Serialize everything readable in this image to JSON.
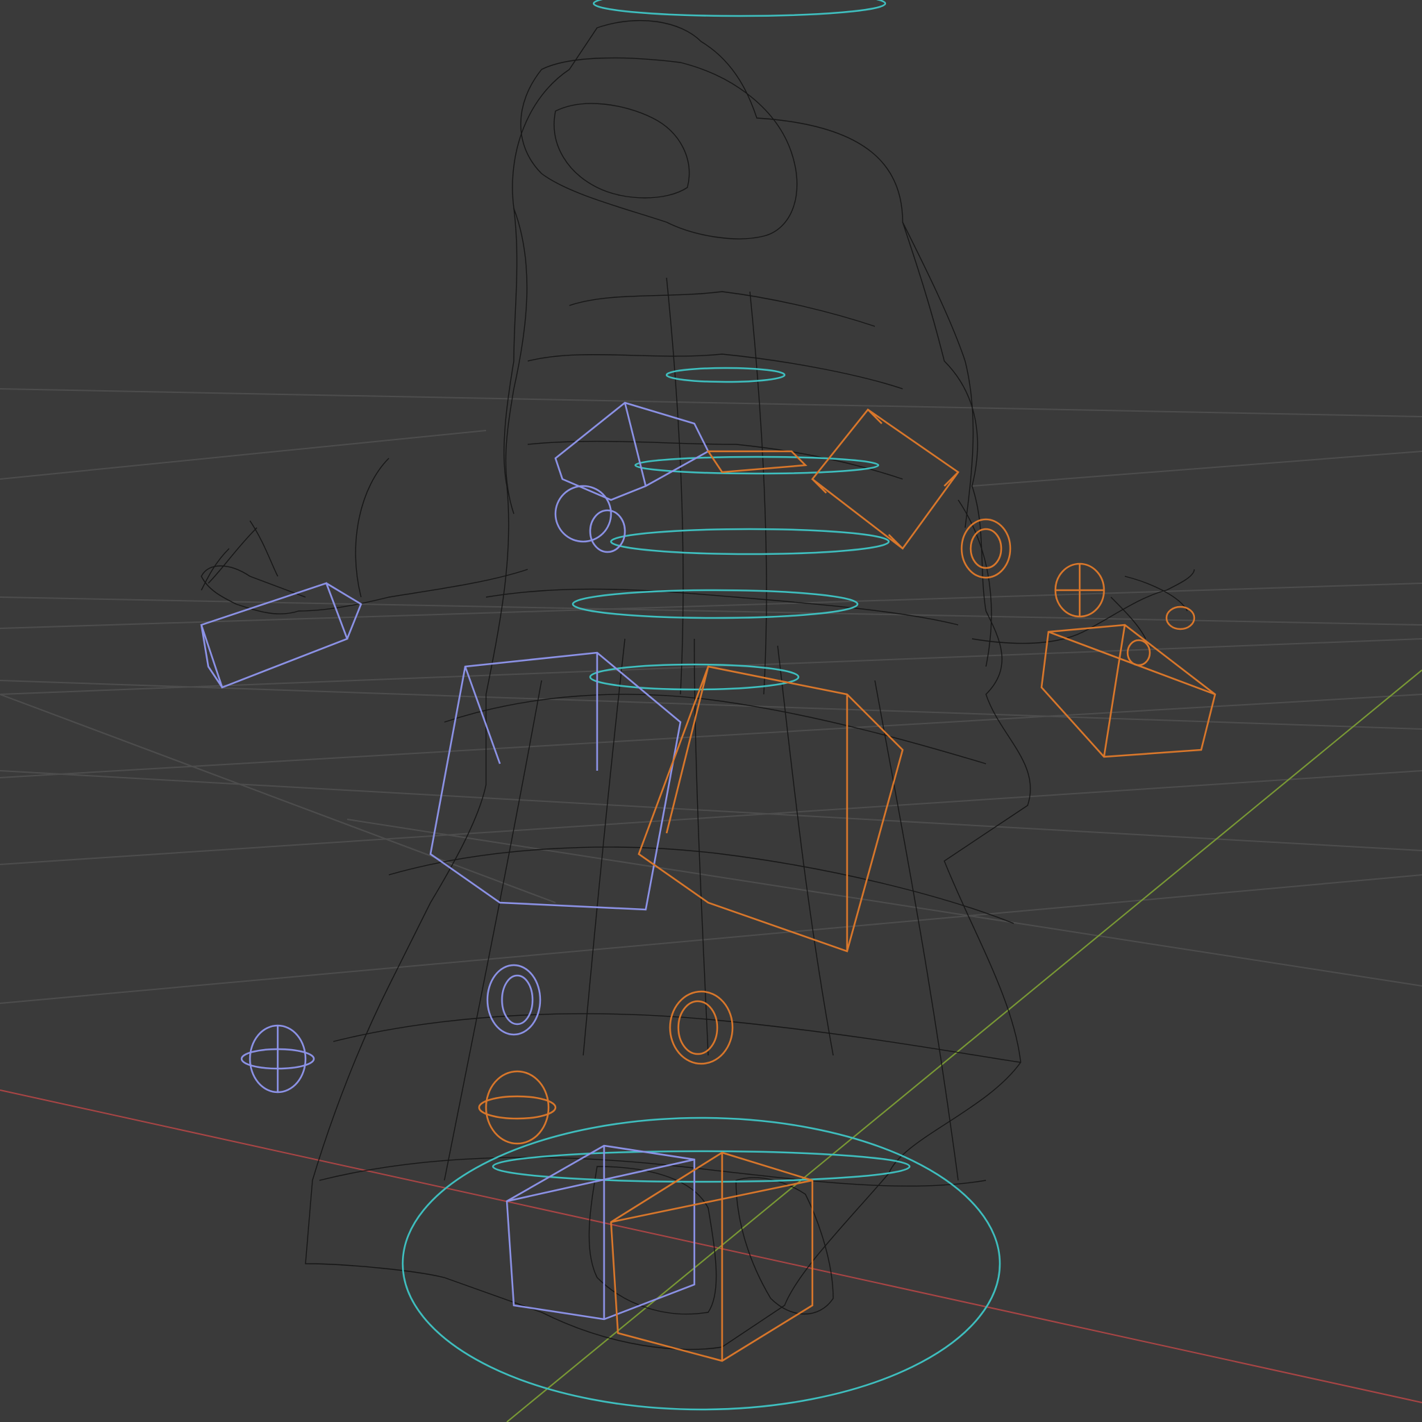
{
  "viewport": {
    "mode": "wireframe",
    "colors": {
      "background": "#3a3a3a",
      "grid": "#4d4d4d",
      "x_axis": "#a84545",
      "y_axis": "#7a9a35",
      "mesh": "#111111",
      "rig_left": "#8c92e6",
      "rig_right": "#d9772b",
      "rig_center": "#3fbfbf"
    }
  }
}
